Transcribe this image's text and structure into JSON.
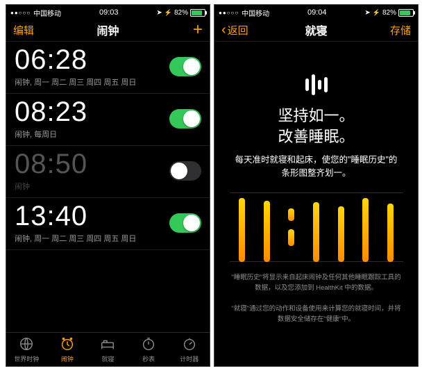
{
  "left": {
    "status": {
      "carrier": "中国移动",
      "signal_dots": "●●○○○",
      "time": "09:03",
      "battery_pct": "82%",
      "battery_fill": 82
    },
    "nav": {
      "left": "编辑",
      "title": "闹钟",
      "right_is_plus": true
    },
    "alarms": [
      {
        "time": "06:28",
        "sub": "闹钟, 周一 周二 周三 周四 周五 周日",
        "on": true
      },
      {
        "time": "08:23",
        "sub": "闹钟, 每周日",
        "on": true
      },
      {
        "time": "08:50",
        "sub": "闹钟",
        "on": false
      },
      {
        "time": "13:40",
        "sub": "闹钟, 周一 周二 周三 周四 周五 周日",
        "on": true
      }
    ],
    "tabs": [
      {
        "key": "world",
        "label": "世界时钟"
      },
      {
        "key": "alarm",
        "label": "闹钟"
      },
      {
        "key": "sleep",
        "label": "就寝"
      },
      {
        "key": "stop",
        "label": "秒表"
      },
      {
        "key": "timer",
        "label": "计时器"
      }
    ],
    "active_tab": "alarm"
  },
  "right": {
    "status": {
      "carrier": "中国移动",
      "signal_dots": "●●○○○",
      "time": "09:04",
      "battery_pct": "82%",
      "battery_fill": 82
    },
    "nav": {
      "back": "返回",
      "title": "就寝",
      "right": "存储"
    },
    "hero": [
      "坚持如一。",
      "改善睡眠。"
    ],
    "desc": "每天准时就寝和起床，使您的\"睡眠历史\"的条形图整齐划一。",
    "chart_data": {
      "type": "bar",
      "categories": [
        "1",
        "2",
        "3",
        "4",
        "5",
        "6",
        "7"
      ],
      "values": [
        92,
        88,
        18,
        86,
        80,
        92,
        84
      ],
      "gap_index": 2,
      "gap_segments": [
        18,
        24
      ],
      "ylim": [
        0,
        100
      ],
      "hlines_pct": [
        0,
        100
      ]
    },
    "footnotes": [
      "\"睡眠历史\"将显示来自起床闹钟及任何其他睡眠跟踪工具的数据，以及您添加到 HealthKit 中的数据。",
      "\"就寝\"通过您的动作和设备使用来计算您的就寝时间，并将数据安全储存在\"健康\"中。"
    ]
  }
}
